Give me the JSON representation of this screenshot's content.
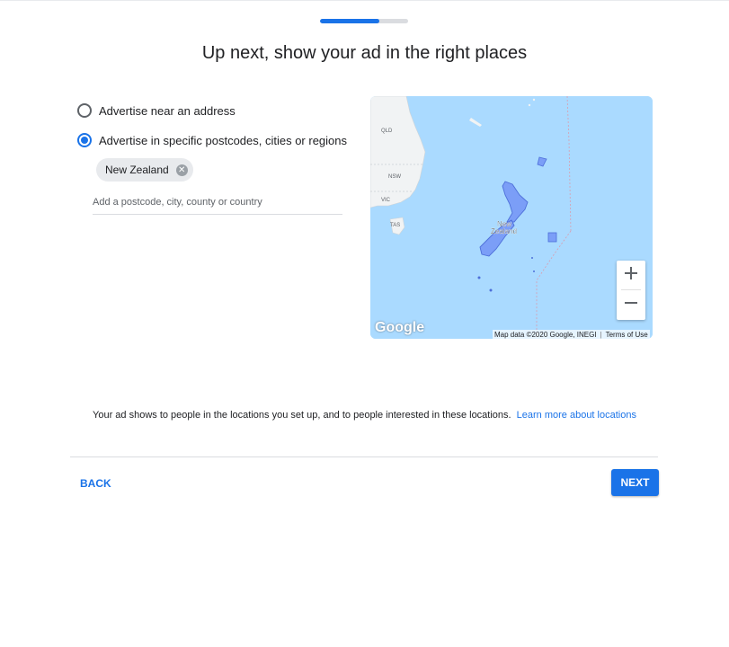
{
  "progress": {
    "fraction": 0.67
  },
  "title": "Up next, show your ad in the right places",
  "options": [
    {
      "label": "Advertise near an address",
      "checked": false
    },
    {
      "label": "Advertise in specific postcodes, cities or regions",
      "checked": true
    }
  ],
  "chip": {
    "label": "New Zealand",
    "close_icon": "close-circle-icon"
  },
  "location_input": {
    "placeholder": "Add a postcode, city, county or country",
    "value": ""
  },
  "map": {
    "labels": {
      "qld": "QLD",
      "nsw": "NSW",
      "vic": "VIC",
      "tas": "TAS",
      "nz_line1": "New",
      "nz_line2": "Zealand"
    },
    "logo": "Google",
    "credit": "Map data ©2020 Google, INEGI",
    "terms": "Terms of Use",
    "zoom_in": "+",
    "zoom_out": "−",
    "colors": {
      "water": "#aadaff",
      "land": "#f1f3f4",
      "highlight": "#7b9ef7",
      "highlight_stroke": "#4d6fd9"
    }
  },
  "footer": {
    "info_text": "Your ad shows to people in the locations you set up, and to people interested in these locations.",
    "learn_more": "Learn more about locations",
    "back_label": "BACK",
    "next_label": "NEXT"
  },
  "colors": {
    "accent": "#1a73e8",
    "track": "#dadce0"
  }
}
